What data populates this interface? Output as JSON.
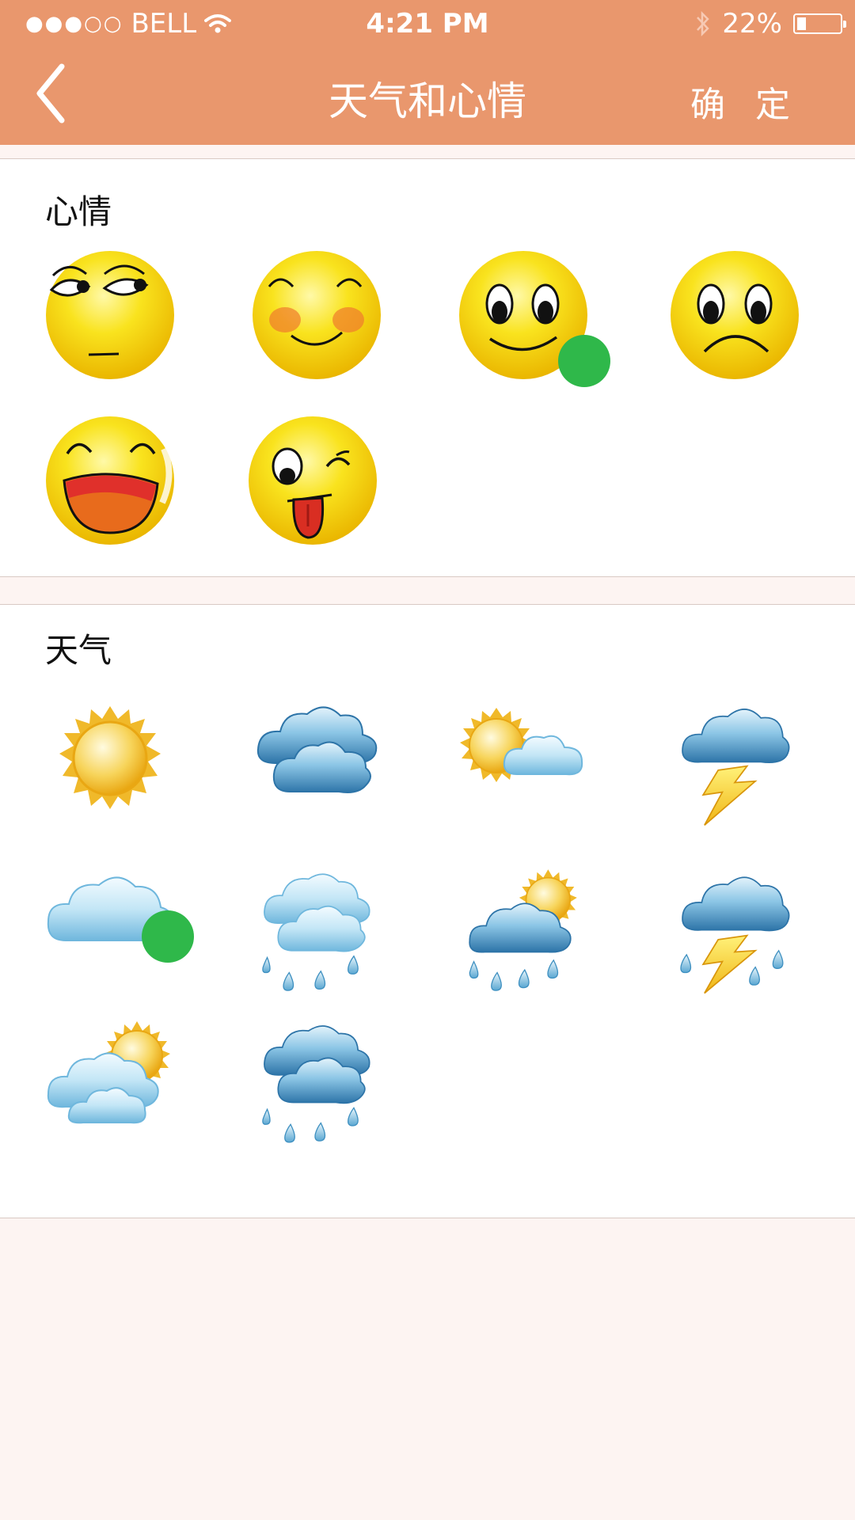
{
  "status_bar": {
    "carrier": "BELL",
    "time": "4:21 PM",
    "battery": "22%",
    "signal_dots": "●●●○○",
    "battery_level": 0.22
  },
  "nav": {
    "title": "天气和心情",
    "confirm_label": "确 定",
    "back_icon": "chevron-left-icon"
  },
  "mood_section": {
    "title": "心情",
    "items": [
      {
        "name": "meh-face-icon",
        "selected": false
      },
      {
        "name": "blush-face-icon",
        "selected": false
      },
      {
        "name": "smile-face-icon",
        "selected": true
      },
      {
        "name": "sad-face-icon",
        "selected": false
      },
      {
        "name": "laughing-face-icon",
        "selected": false
      },
      {
        "name": "wink-tongue-face-icon",
        "selected": false
      }
    ]
  },
  "weather_section": {
    "title": "天气",
    "items": [
      {
        "name": "sunny-icon",
        "selected": false
      },
      {
        "name": "overcast-icon",
        "selected": false
      },
      {
        "name": "partly-cloudy-icon",
        "selected": false
      },
      {
        "name": "thunder-icon",
        "selected": false
      },
      {
        "name": "cloudy-icon",
        "selected": true
      },
      {
        "name": "rain-icon",
        "selected": false
      },
      {
        "name": "sun-shower-icon",
        "selected": false
      },
      {
        "name": "thunderstorm-rain-icon",
        "selected": false
      },
      {
        "name": "sun-behind-cloud-icon",
        "selected": false
      },
      {
        "name": "heavy-rain-icon",
        "selected": false
      }
    ]
  },
  "colors": {
    "header": "#e9976d",
    "check": "#2fb84a",
    "face": "#f7dc0b",
    "page_bg": "#fdf4f2"
  }
}
